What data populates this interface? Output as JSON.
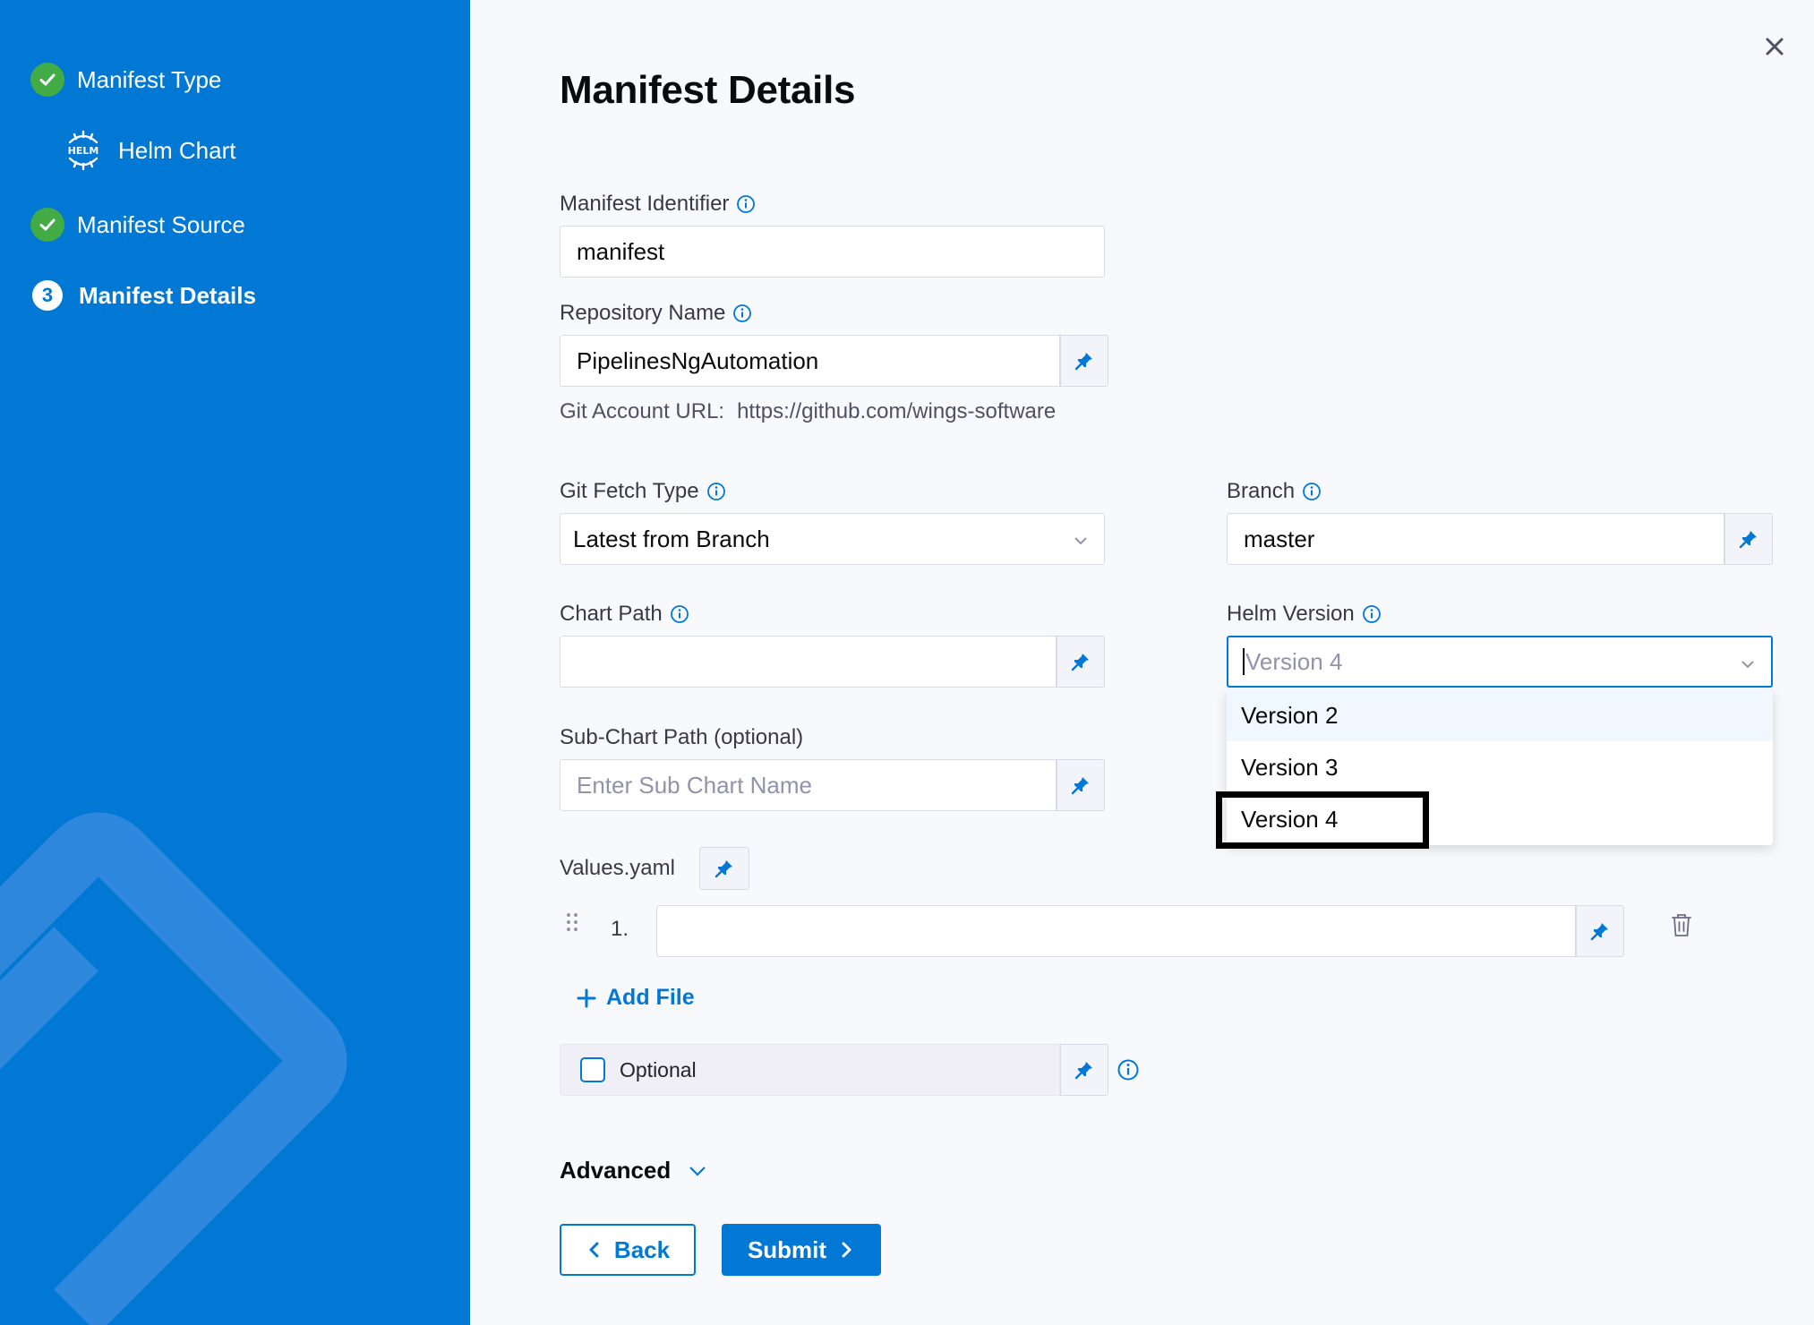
{
  "sidebar": {
    "steps": [
      {
        "label": "Manifest Type",
        "status": "complete",
        "icon": "check-icon"
      },
      {
        "label": "Helm Chart",
        "status": "selected-type",
        "icon": "helm-icon"
      },
      {
        "label": "Manifest Source",
        "status": "complete",
        "icon": "check-icon"
      },
      {
        "label": "Manifest Details",
        "status": "active",
        "number": "3"
      }
    ]
  },
  "main": {
    "title": "Manifest Details",
    "manifest_identifier": {
      "label": "Manifest Identifier",
      "value": "manifest"
    },
    "repository_name": {
      "label": "Repository Name",
      "value": "PipelinesNgAutomation"
    },
    "git_account_url": {
      "label": "Git Account URL:",
      "value": "https://github.com/wings-software"
    },
    "git_fetch_type": {
      "label": "Git Fetch Type",
      "value": "Latest from Branch"
    },
    "branch": {
      "label": "Branch",
      "value": "master"
    },
    "chart_path": {
      "label": "Chart Path",
      "value": ""
    },
    "helm_version": {
      "label": "Helm Version",
      "placeholder": "Version 4",
      "options": [
        "Version 2",
        "Version 3",
        "Version 4"
      ]
    },
    "sub_chart_path": {
      "label": "Sub-Chart Path (optional)",
      "placeholder": "Enter Sub Chart Name"
    },
    "values_yaml": {
      "label": "Values.yaml",
      "rows": [
        {
          "number": "1.",
          "value": ""
        }
      ]
    },
    "add_file_label": "Add File",
    "optional_label": "Optional",
    "advanced_label": "Advanced",
    "back_label": "Back",
    "submit_label": "Submit"
  },
  "colors": {
    "primary": "#0278d5",
    "success": "#42ab45",
    "background": "#f7f9fc"
  }
}
